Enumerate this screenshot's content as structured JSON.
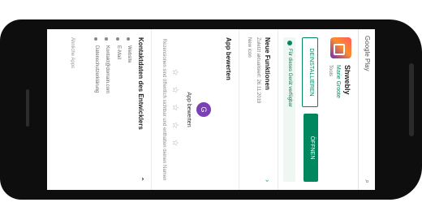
{
  "store": {
    "title": "Google Play",
    "search_icon": "search-icon"
  },
  "app": {
    "name": "Shwebly",
    "developer": "Marie Groote",
    "category": "Tools",
    "icon": "app-icon"
  },
  "buttons": {
    "secondary": "DEINSTALLIEREN",
    "primary": "ÖFFNEN"
  },
  "notice": {
    "text": "Für dieses Gerät verfügbar"
  },
  "sections": {
    "whats_new_title": "Neue Funktionen",
    "whats_new_meta": "Zuletzt aktualisiert: 26.11.2019",
    "whats_new_text": "New icon",
    "rate_title": "App bewerten"
  },
  "rating": {
    "avatar_letter": "G",
    "label": "App bewerten",
    "stars": "☆ ☆ ☆ ☆ ☆",
    "hint": "Rezensionen sind öffentlich sichtbar und enthalten deinen Namen"
  },
  "contact": {
    "title": "Kontaktdaten des Entwicklers",
    "items": [
      "Website",
      "E-Mail",
      "Kontakt@domain.com",
      "Datenschutzerklärung"
    ]
  },
  "footer": {
    "text": "Ähnliche Apps"
  },
  "colors": {
    "accent": "#01875f",
    "avatar": "#7b3fb6",
    "frame": "#0e0e0e"
  }
}
